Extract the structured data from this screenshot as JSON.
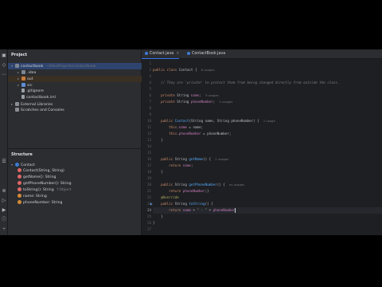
{
  "project_panel": {
    "title": "Project",
    "tree": [
      {
        "label": "contactbook",
        "path": "~/IdeaProjects/contactbook",
        "kind": "folder",
        "expanded": true,
        "selected": true
      },
      {
        "label": ".idea",
        "kind": "folder",
        "expanded": false
      },
      {
        "label": "out",
        "kind": "folder-orange",
        "expanded": false
      },
      {
        "label": "src",
        "kind": "folder-blue",
        "expanded": false
      },
      {
        "label": ".gitignore",
        "kind": "file"
      },
      {
        "label": "contactbook.iml",
        "kind": "file"
      },
      {
        "label": "External Libraries",
        "kind": "lib",
        "expanded": false
      },
      {
        "label": "Scratches and Consoles",
        "kind": "lib"
      }
    ]
  },
  "structure_panel": {
    "title": "Structure",
    "items": [
      {
        "label": "Contact",
        "extra": "",
        "kind": "class"
      },
      {
        "label": "Contact(String, String)",
        "extra": "",
        "kind": "method"
      },
      {
        "label": "getName(): String",
        "extra": "",
        "kind": "method"
      },
      {
        "label": "getPhoneNumber(): String",
        "extra": "",
        "kind": "method"
      },
      {
        "label": "toString(): String",
        "extra": "↑Object",
        "kind": "method"
      },
      {
        "label": "name: String",
        "extra": "",
        "kind": "field"
      },
      {
        "label": "phoneNumber: String",
        "extra": "",
        "kind": "field"
      }
    ]
  },
  "tabs": [
    {
      "label": "Contact.java",
      "active": true
    },
    {
      "label": "ContactBook.java",
      "active": false
    }
  ],
  "tab_close_glyph": "×",
  "editor": {
    "current_line": 24,
    "lines": [
      {
        "n": "1",
        "html": ""
      },
      {
        "n": "2",
        "html": "<span class=\"kw\">public class</span> Contact {  <span class=\"hint\">6 usages</span>"
      },
      {
        "n": "3",
        "html": ""
      },
      {
        "n": "4",
        "html": "    <span class=\"cmt\">// They are 'private' to protect them from being changed directly from outside the class.</span>"
      },
      {
        "n": "5",
        "html": ""
      },
      {
        "n": "6",
        "html": "    <span class=\"kw\">private</span> String <span class=\"fld\">name</span>;  <span class=\"hint\">3 usages</span>"
      },
      {
        "n": "7",
        "html": "    <span class=\"kw\">private</span> String <span class=\"fld\">phoneNumber</span>;  <span class=\"hint\">3 usages</span>"
      },
      {
        "n": "8",
        "html": ""
      },
      {
        "n": "9",
        "html": ""
      },
      {
        "n": "10",
        "html": "    <span class=\"kw\">public</span> <span class=\"mth\">Contact</span>(String name, String phoneNumber) {  <span class=\"hint\">1 usage</span>"
      },
      {
        "n": "11",
        "html": "        <span class=\"kw\">this</span>.<span class=\"fld\">name</span> = name;"
      },
      {
        "n": "12",
        "html": "        <span class=\"kw\">this</span>.<span class=\"fld\">phoneNumber</span> = phoneNumber;"
      },
      {
        "n": "13",
        "html": "    }"
      },
      {
        "n": "14",
        "html": ""
      },
      {
        "n": "15",
        "html": ""
      },
      {
        "n": "16",
        "html": "    <span class=\"kw\">public</span> String <span class=\"mth\">getName</span>() {  <span class=\"hint\">2 usages</span>"
      },
      {
        "n": "17",
        "html": "        <span class=\"kw\">return</span> <span class=\"fld\">name</span>;"
      },
      {
        "n": "18",
        "html": "    }"
      },
      {
        "n": "19",
        "html": ""
      },
      {
        "n": "20",
        "html": "    <span class=\"kw\">public</span> String <span class=\"mth\">getPhoneNumber</span>() {  <span class=\"hint\">no usages</span>"
      },
      {
        "n": "21",
        "html": "        <span class=\"kw\">return</span> <span class=\"fld\">phoneNumber</span>;}"
      },
      {
        "n": "22",
        "html": "    <span class=\"ann\">@Override</span>"
      },
      {
        "n": "23",
        "html": "    <span class=\"kw\">public</span> String <span class=\"mth\">toString</span>() {"
      },
      {
        "n": "24",
        "html": "        <span class=\"kw\">return</span> <span class=\"fld\">name</span> + <span class=\"str\">\" - \"</span> + <span class=\"fld\">phoneNumber</span><span class=\"caret\"></span>"
      },
      {
        "n": "25",
        "html": "    }"
      },
      {
        "n": "26",
        "html": "}"
      },
      {
        "n": "27",
        "html": ""
      }
    ]
  }
}
